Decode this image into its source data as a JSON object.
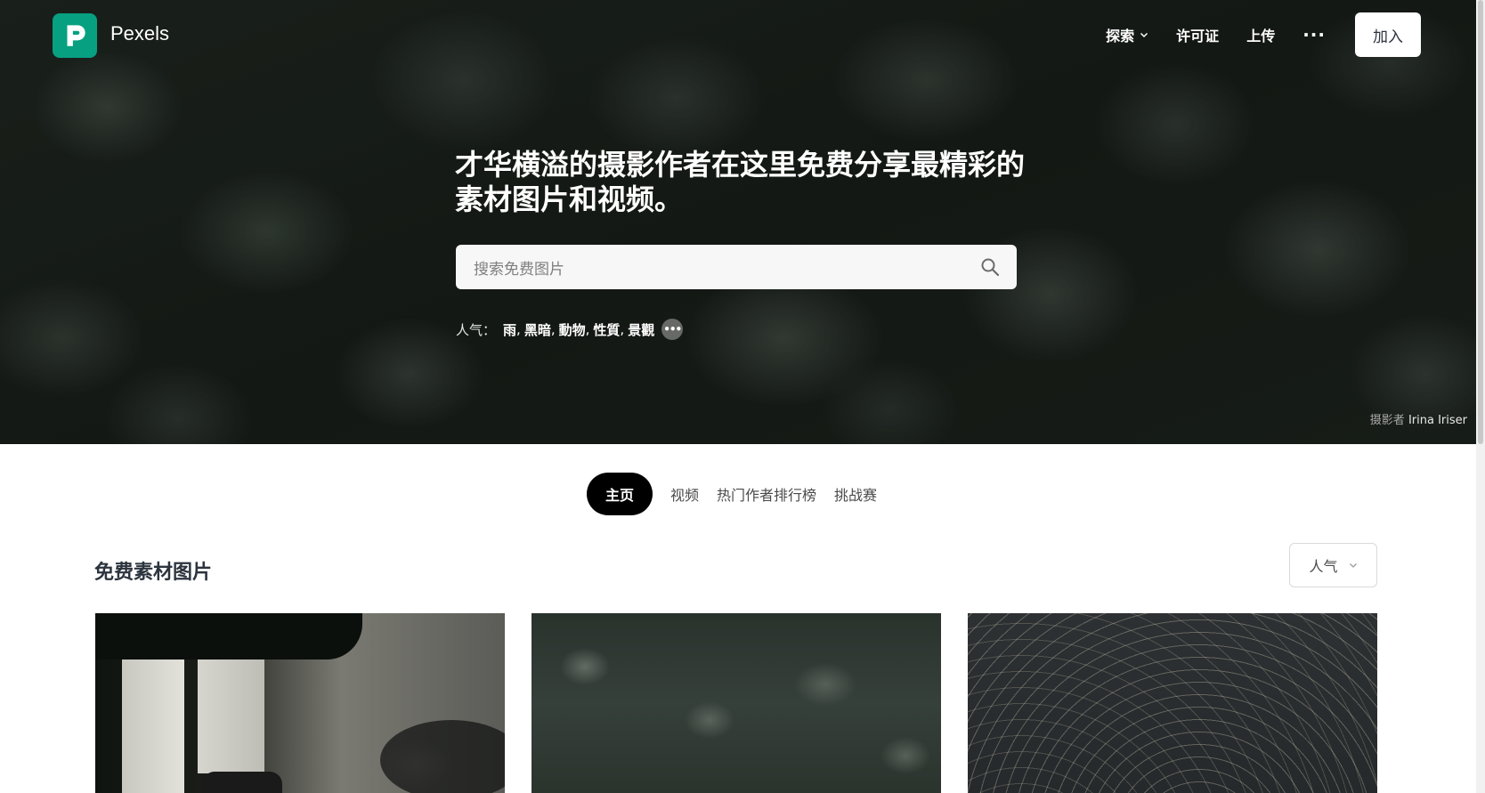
{
  "brand": {
    "name": "Pexels"
  },
  "nav": {
    "explore": "探索",
    "license": "许可证",
    "upload": "上传",
    "more": "···",
    "join": "加入"
  },
  "hero": {
    "headline": "才华横溢的摄影作者在这里免费分享最精彩的素材图片和视频。",
    "search_placeholder": "搜索免费图片",
    "popular_label": "人气：",
    "popular_tags": [
      "雨",
      "黑暗",
      "動物",
      "性質",
      "景觀"
    ],
    "more_tags": "•••",
    "credit_prefix": "摄影者",
    "credit_name": "Irina Iriser"
  },
  "tabs": [
    "主页",
    "视频",
    "热门作者排行榜",
    "挑战赛"
  ],
  "active_tab": "主页",
  "section": {
    "title": "免费素材图片",
    "sort_label": "人气"
  },
  "icons": {
    "logo": "pexels-logo-icon",
    "search": "search-icon",
    "chevron": "chevron-down-icon"
  },
  "colors": {
    "brand_green": "#07a081",
    "tab_active_bg": "#000000"
  }
}
